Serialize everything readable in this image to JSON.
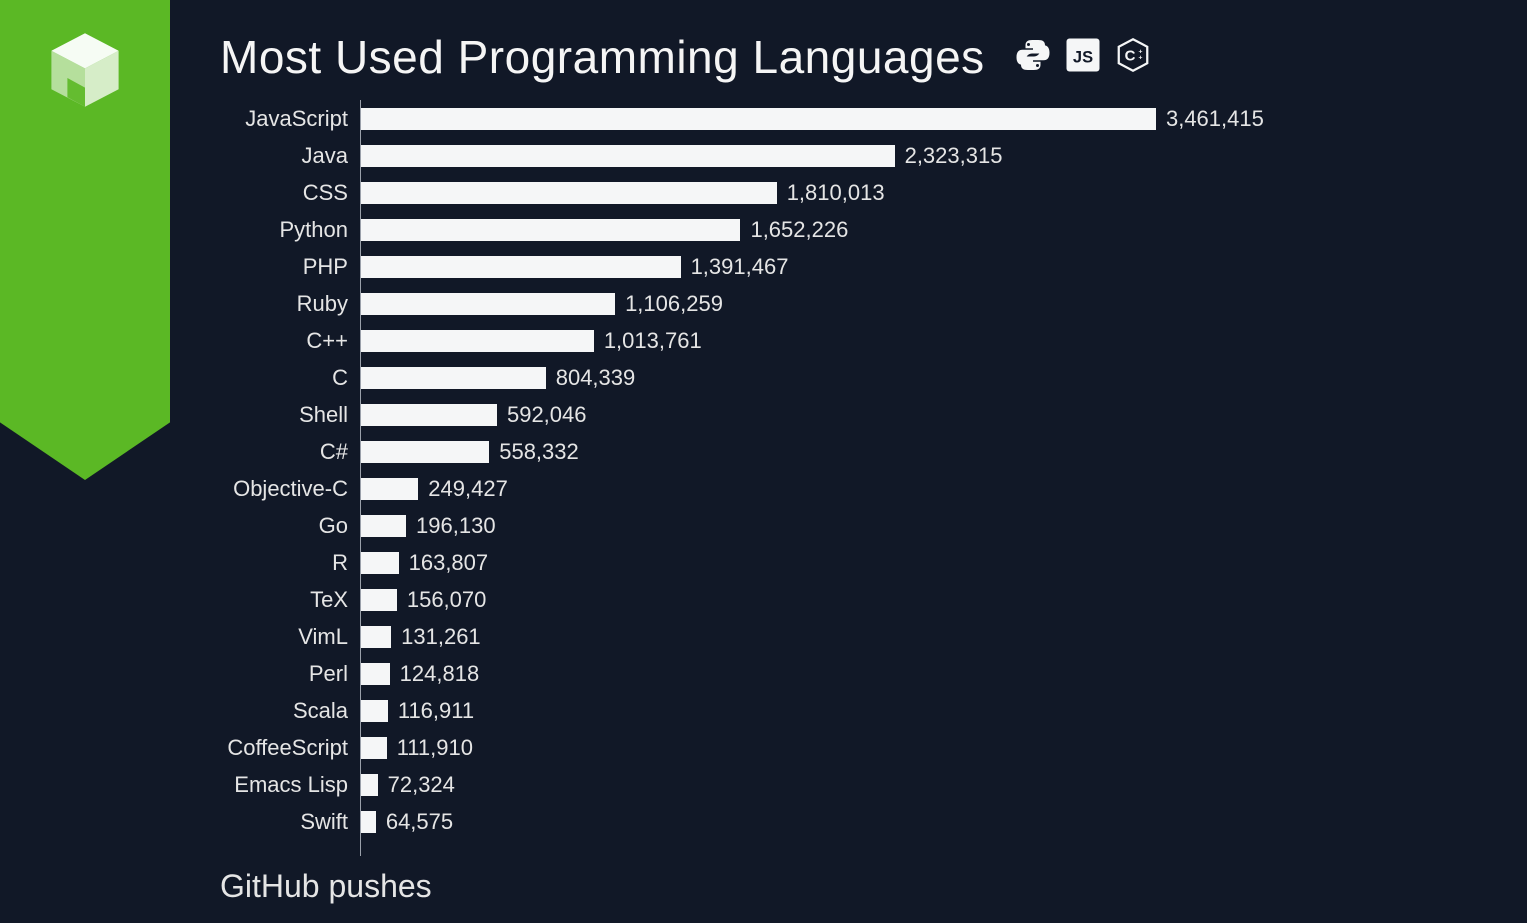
{
  "title": "Most Used Programming Languages",
  "subtitle": "GitHub pushes",
  "accent_color": "#5bb825",
  "bar_color": "#f5f6f7",
  "background_color": "#111827",
  "icons": [
    "python-icon",
    "javascript-icon",
    "cpp-icon"
  ],
  "chart_data": {
    "type": "bar",
    "orientation": "horizontal",
    "title": "Most Used Programming Languages",
    "xlabel": "GitHub pushes",
    "ylabel": "",
    "categories": [
      "JavaScript",
      "Java",
      "CSS",
      "Python",
      "PHP",
      "Ruby",
      "C++",
      "C",
      "Shell",
      "C#",
      "Objective-C",
      "Go",
      "R",
      "TeX",
      "VimL",
      "Perl",
      "Scala",
      "CoffeeScript",
      "Emacs Lisp",
      "Swift"
    ],
    "values": [
      3461415,
      2323315,
      1810013,
      1652226,
      1391467,
      1106259,
      1013761,
      804339,
      592046,
      558332,
      249427,
      196130,
      163807,
      156070,
      131261,
      124818,
      116911,
      111910,
      72324,
      64575
    ],
    "value_labels": [
      "3,461,415",
      "2,323,315",
      "1,810,013",
      "1,652,226",
      "1,391,467",
      "1,106,259",
      "1,013,761",
      "804,339",
      "592,046",
      "558,332",
      "249,427",
      "196,130",
      "163,807",
      "156,070",
      "131,261",
      "124,818",
      "116,911",
      "111,910",
      "72,324",
      "64,575"
    ],
    "xlim": [
      0,
      3600000
    ]
  }
}
